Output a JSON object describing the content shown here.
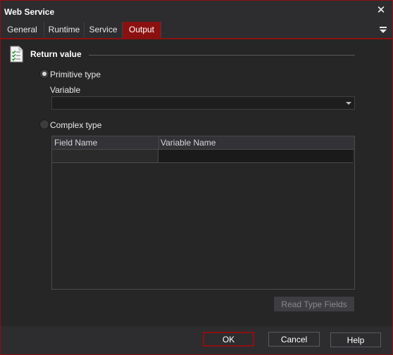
{
  "window": {
    "title": "Web Service"
  },
  "tabs": [
    {
      "label": "General"
    },
    {
      "label": "Runtime"
    },
    {
      "label": "Service"
    },
    {
      "label": "Output"
    }
  ],
  "section": {
    "title": "Return value",
    "icon": "checklist-icon"
  },
  "primitive": {
    "label": "Primitive type",
    "checked": true,
    "variable_label": "Variable",
    "variable_value": ""
  },
  "complex": {
    "label": "Complex type",
    "checked": false
  },
  "grid": {
    "columns": [
      "Field Name",
      "Variable Name"
    ],
    "rows": [
      {
        "field_name": "",
        "variable_name": ""
      }
    ]
  },
  "buttons": {
    "read_type_fields": "Read Type Fields",
    "ok": "OK",
    "cancel": "Cancel",
    "help": "Help"
  },
  "colors": {
    "accent": "#8b1111",
    "background": "#2d2d30",
    "panel": "#262626"
  }
}
